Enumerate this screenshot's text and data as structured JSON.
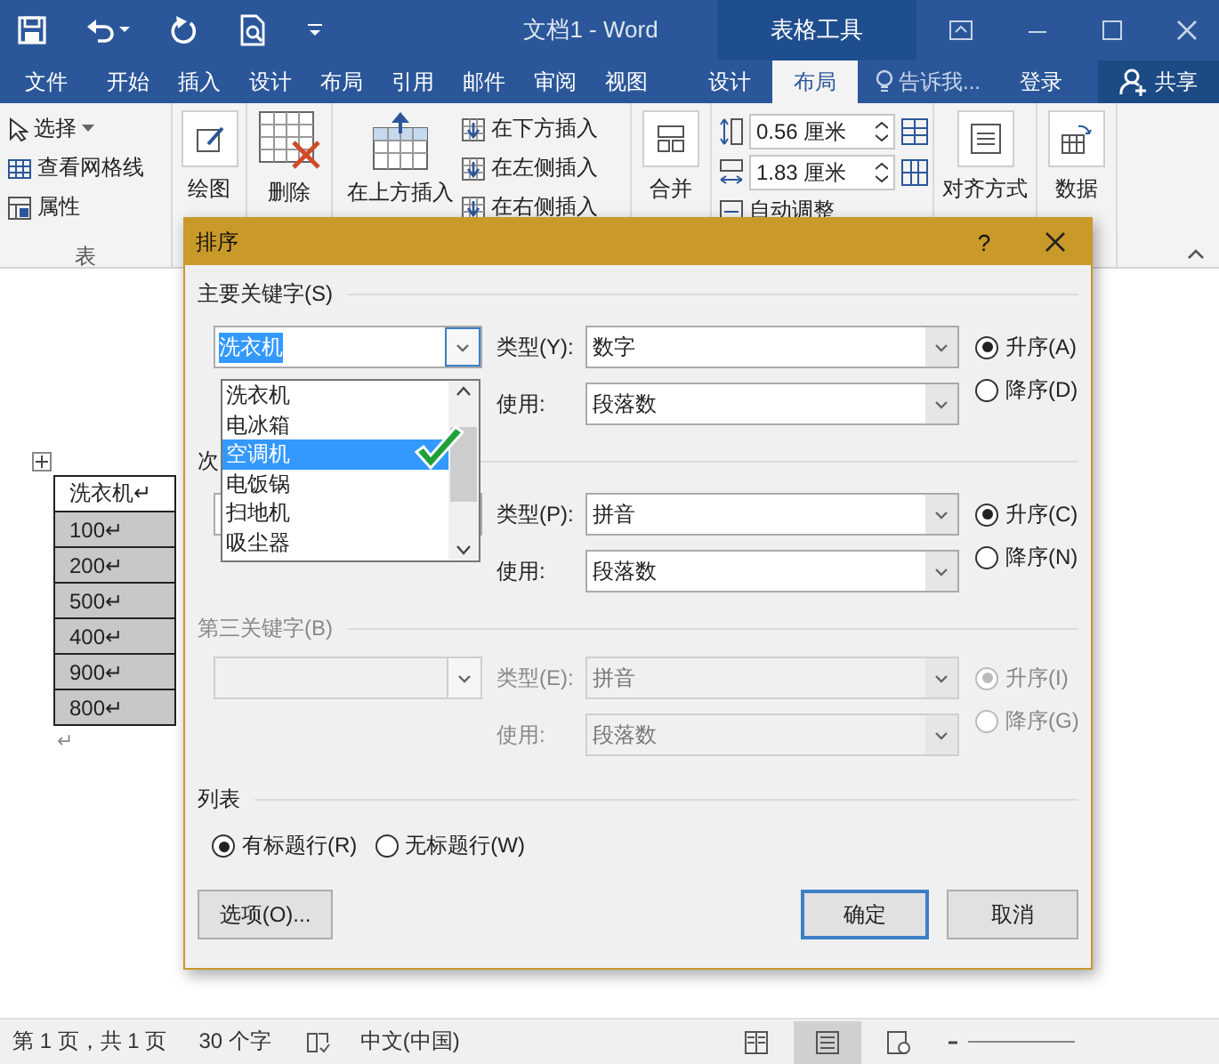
{
  "window": {
    "title": "文档1 - Word",
    "context_group": "表格工具"
  },
  "ribbon_tabs": [
    {
      "label": "文件",
      "selected": false,
      "kind": "file"
    },
    {
      "label": "开始",
      "selected": false,
      "kind": "main"
    },
    {
      "label": "插入",
      "selected": false,
      "kind": "main"
    },
    {
      "label": "设计",
      "selected": false,
      "kind": "main"
    },
    {
      "label": "布局",
      "selected": false,
      "kind": "main"
    },
    {
      "label": "引用",
      "selected": false,
      "kind": "main"
    },
    {
      "label": "邮件",
      "selected": false,
      "kind": "main"
    },
    {
      "label": "审阅",
      "selected": false,
      "kind": "main"
    },
    {
      "label": "视图",
      "selected": false,
      "kind": "main"
    },
    {
      "label": "设计",
      "selected": false,
      "kind": "context"
    },
    {
      "label": "布局",
      "selected": true,
      "kind": "context"
    }
  ],
  "tell_me": "告诉我...",
  "sign_in": "登录",
  "share": "共享",
  "ribbon": {
    "table_items": [
      "选择",
      "查看网格线",
      "属性"
    ],
    "table_group_label": "表",
    "draw": "绘图",
    "delete": "删除",
    "insert_above": "在上方插入",
    "insert_small": [
      "在下方插入",
      "在左侧插入",
      "在右侧插入"
    ],
    "merge": "合并",
    "cell_height": "0.56 厘米",
    "cell_width": "1.83 厘米",
    "autofit": "自动调整",
    "align": "对齐方式",
    "data": "数据"
  },
  "table": {
    "rows": [
      {
        "text": "洗衣机↵",
        "selected": false
      },
      {
        "text": "100↵",
        "selected": true
      },
      {
        "text": "200↵",
        "selected": true
      },
      {
        "text": "500↵",
        "selected": true
      },
      {
        "text": "400↵",
        "selected": true
      },
      {
        "text": "900↵",
        "selected": true
      },
      {
        "text": "800↵",
        "selected": true
      }
    ],
    "end_mark": "↵"
  },
  "dialog": {
    "title": "排序",
    "help": "?",
    "sections": [
      {
        "label": "主要关键字(S)",
        "disabled": false,
        "value": "洗衣机",
        "type_label": "类型(Y):",
        "type_value": "数字",
        "using_label": "使用:",
        "using_value": "段落数",
        "order": [
          {
            "label": "升序(A)",
            "selected": true
          },
          {
            "label": "降序(D)",
            "selected": false
          }
        ]
      },
      {
        "label": "次",
        "disabled": false,
        "type_label": "类型(P):",
        "type_value": "拼音",
        "using_label": "使用:",
        "using_value": "段落数",
        "order": [
          {
            "label": "升序(C)",
            "selected": true
          },
          {
            "label": "降序(N)",
            "selected": false
          }
        ]
      },
      {
        "label": "第三关键字(B)",
        "disabled": true,
        "type_label": "类型(E):",
        "type_value": "拼音",
        "using_label": "使用:",
        "using_value": "段落数",
        "order": [
          {
            "label": "升序(I)",
            "selected": true
          },
          {
            "label": "降序(G)",
            "selected": false
          }
        ]
      }
    ],
    "dropdown": [
      {
        "label": "洗衣机",
        "selected": false
      },
      {
        "label": "电冰箱",
        "selected": false
      },
      {
        "label": "空调机",
        "selected": true
      },
      {
        "label": "电饭锅",
        "selected": false
      },
      {
        "label": "扫地机",
        "selected": false
      },
      {
        "label": "吸尘器",
        "selected": false
      }
    ],
    "list_label": "列表",
    "header_options": [
      {
        "label": "有标题行(R)",
        "selected": true
      },
      {
        "label": "无标题行(W)",
        "selected": false
      }
    ],
    "buttons": [
      {
        "label": "选项(O)...",
        "kind": "left"
      },
      {
        "label": "确定",
        "kind": "default"
      },
      {
        "label": "取消",
        "kind": "normal"
      }
    ]
  },
  "status_bar": {
    "page": "第 1 页，共 1 页",
    "words": "30 个字",
    "language": "中文(中国)",
    "views": [
      {
        "kind": "read",
        "selected": false
      },
      {
        "kind": "print",
        "selected": true
      },
      {
        "kind": "web",
        "selected": false
      }
    ]
  }
}
